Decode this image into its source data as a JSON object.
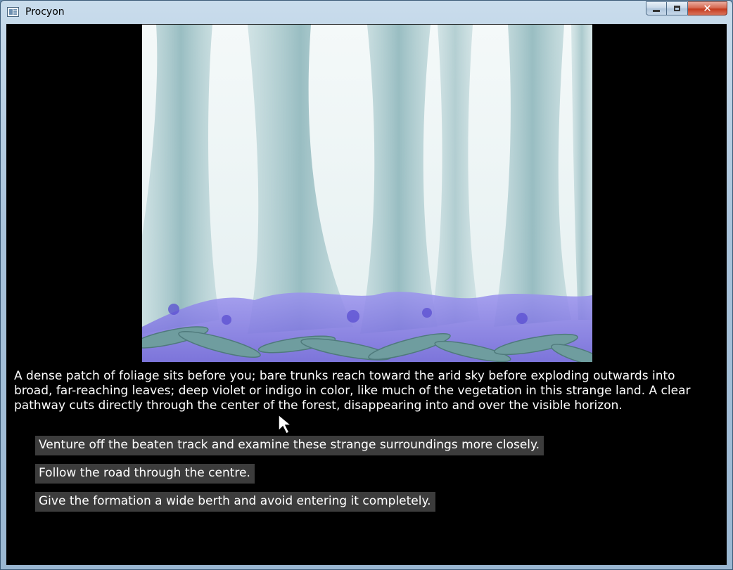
{
  "window": {
    "title": "Procyon",
    "controls": {
      "minimize": "–",
      "maximize": "□",
      "close": "✕"
    }
  },
  "scene": {
    "illustration": "painted-forest-scene",
    "palette": {
      "sky": "#eef5f6",
      "trunks": "#9fc2c6",
      "foliage": "#7d74e0",
      "leaves": "#6d9a9a"
    }
  },
  "narration": "A dense patch of foliage sits before you; bare trunks reach toward the arid sky before exploding outwards into broad, far-reaching leaves; deep violet or indigo in color, like much of the vegetation in this strange land. A clear pathway cuts directly through the center of the forest, disappearing into and over the visible horizon.",
  "choices": [
    {
      "label": "Venture off the beaten track and examine these strange surroundings more closely."
    },
    {
      "label": "Follow the road through the centre."
    },
    {
      "label": "Give the formation a wide berth and avoid entering it completely."
    }
  ]
}
